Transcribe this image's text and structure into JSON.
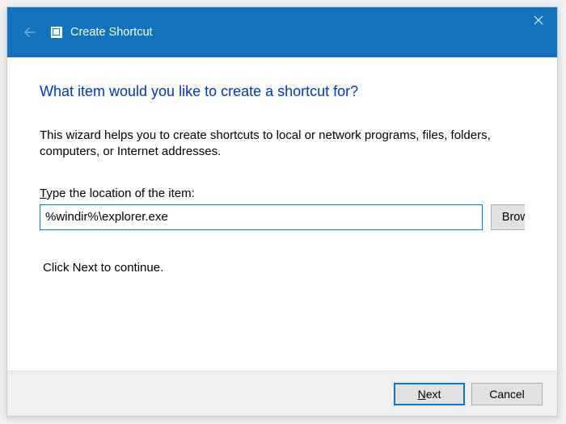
{
  "titlebar": {
    "title": "Create Shortcut"
  },
  "content": {
    "heading": "What item would you like to create a shortcut for?",
    "description": "This wizard helps you to create shortcuts to local or network programs, files, folders, computers, or Internet addresses.",
    "location_label_prefix": "T",
    "location_label_rest": "ype the location of the item:",
    "location_value": "%windir%\\explorer.exe",
    "browse_prefix": "B",
    "browse_rest": "rowse...",
    "continue_text": "Click Next to continue."
  },
  "footer": {
    "next_prefix": "N",
    "next_rest": "ext",
    "cancel": "Cancel"
  },
  "icons": {
    "back": "back-arrow-icon",
    "close": "close-icon",
    "app": "shortcut-icon"
  }
}
